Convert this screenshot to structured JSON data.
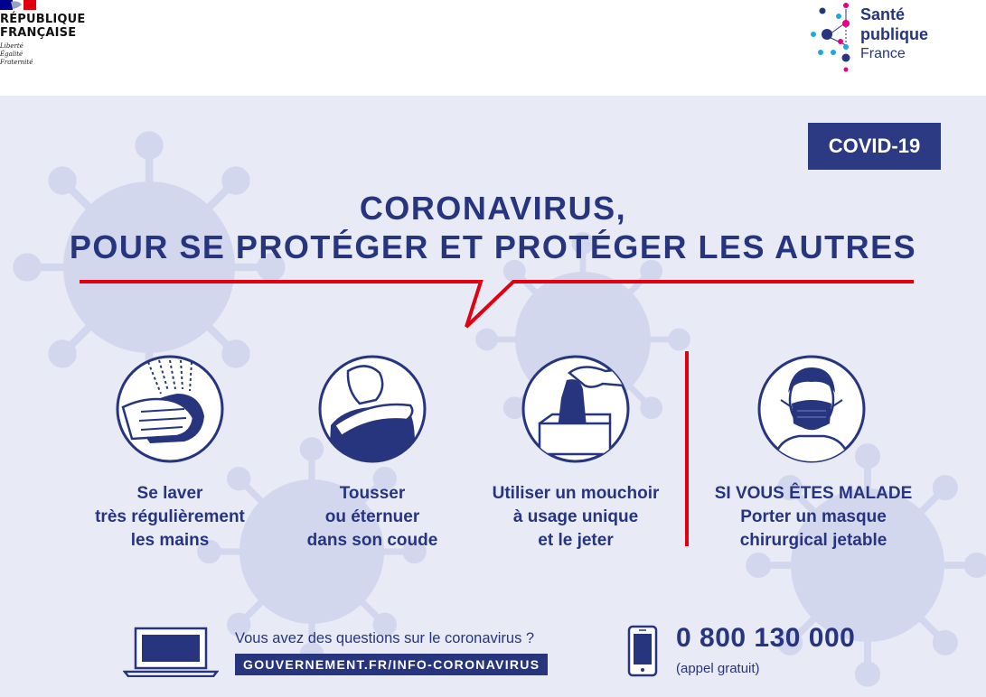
{
  "header": {
    "republique": {
      "line1": "RÉPUBLIQUE",
      "line2": "FRANÇAISE",
      "motto1": "Liberté",
      "motto2": "Égalité",
      "motto3": "Fraternité"
    },
    "sante_publique": {
      "line1": "Santé",
      "line2": "publique",
      "line3": "France"
    }
  },
  "badge": "COVID-19",
  "title": {
    "line1": "CORONAVIRUS,",
    "line2": "POUR SE PROTÉGER ET PROTÉGER LES AUTRES"
  },
  "gestures": [
    {
      "icon": "hand-washing-icon",
      "lines": [
        "Se laver",
        "très régulièrement",
        "les mains"
      ]
    },
    {
      "icon": "cough-elbow-icon",
      "lines": [
        "Tousser",
        "ou éternuer",
        "dans son coude"
      ]
    },
    {
      "icon": "tissue-icon",
      "lines": [
        "Utiliser un mouchoir",
        "à usage unique",
        "et le jeter"
      ]
    },
    {
      "icon": "mask-icon",
      "lines": [
        "SI VOUS ÊTES MALADE",
        "Porter un masque",
        "chirurgical jetable"
      ]
    }
  ],
  "footer": {
    "question": "Vous avez des questions sur le coronavirus ?",
    "url": "GOUVERNEMENT.FR/INFO-CORONAVIRUS",
    "phone": "0 800 130 000",
    "phone_note": "(appel gratuit)"
  },
  "colors": {
    "navy": "#27357e",
    "red": "#e1000f",
    "background": "#e8eaf6",
    "virus": "#d3d7ee"
  }
}
